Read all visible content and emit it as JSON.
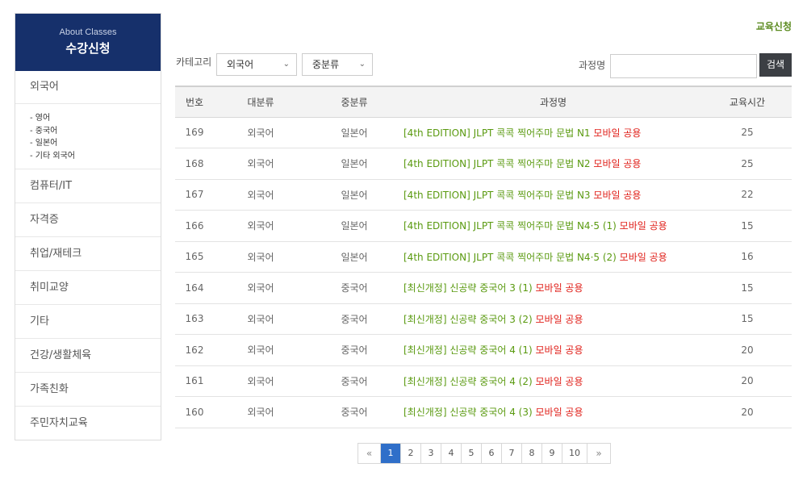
{
  "sidebar": {
    "subtitle": "About Classes",
    "title": "수강신청",
    "first_item": "외국어",
    "sub_items": [
      "- 영어",
      "- 중국어",
      "- 일본어",
      "- 기타 외국어"
    ],
    "items": [
      "컴퓨터/IT",
      "자격증",
      "취업/재테크",
      "취미교양",
      "기타",
      "건강/생활체육",
      "가족친화",
      "주민자치교육"
    ]
  },
  "header": {
    "link": "교육신청"
  },
  "filters": {
    "category_label": "카테고리",
    "select1": "외국어",
    "select2": "중분류",
    "course_label": "과정명",
    "search_value": "",
    "search_button": "검색"
  },
  "table": {
    "headers": [
      "번호",
      "대분류",
      "중분류",
      "과정명",
      "교육시간"
    ],
    "rows": [
      {
        "no": "169",
        "cat": "외국어",
        "sub": "일본어",
        "title": "[4th EDITION] JLPT 콕콕 찍어주마 문법 N1",
        "mobile": "모바일 공용",
        "hours": "25"
      },
      {
        "no": "168",
        "cat": "외국어",
        "sub": "일본어",
        "title": "[4th EDITION] JLPT 콕콕 찍어주마 문법 N2",
        "mobile": "모바일 공용",
        "hours": "25"
      },
      {
        "no": "167",
        "cat": "외국어",
        "sub": "일본어",
        "title": "[4th EDITION] JLPT 콕콕 찍어주마 문법 N3",
        "mobile": "모바일 공용",
        "hours": "22"
      },
      {
        "no": "166",
        "cat": "외국어",
        "sub": "일본어",
        "title": "[4th EDITION] JLPT 콕콕 찍어주마 문법 N4·5 (1)",
        "mobile": "모바일 공용",
        "hours": "15"
      },
      {
        "no": "165",
        "cat": "외국어",
        "sub": "일본어",
        "title": "[4th EDITION] JLPT 콕콕 찍어주마 문법 N4·5 (2)",
        "mobile": "모바일 공용",
        "hours": "16"
      },
      {
        "no": "164",
        "cat": "외국어",
        "sub": "중국어",
        "title": "[최신개정] 신공략 중국어 3 (1)",
        "mobile": "모바일 공용",
        "hours": "15"
      },
      {
        "no": "163",
        "cat": "외국어",
        "sub": "중국어",
        "title": "[최신개정] 신공략 중국어 3 (2)",
        "mobile": "모바일 공용",
        "hours": "15"
      },
      {
        "no": "162",
        "cat": "외국어",
        "sub": "중국어",
        "title": "[최신개정] 신공략 중국어 4 (1)",
        "mobile": "모바일 공용",
        "hours": "20"
      },
      {
        "no": "161",
        "cat": "외국어",
        "sub": "중국어",
        "title": "[최신개정] 신공략 중국어 4 (2)",
        "mobile": "모바일 공용",
        "hours": "20"
      },
      {
        "no": "160",
        "cat": "외국어",
        "sub": "중국어",
        "title": "[최신개정] 신공략 중국어 4 (3)",
        "mobile": "모바일 공용",
        "hours": "20"
      }
    ]
  },
  "pagination": {
    "prev": "«",
    "pages": [
      "1",
      "2",
      "3",
      "4",
      "5",
      "6",
      "7",
      "8",
      "9",
      "10"
    ],
    "active": "1",
    "next": "»"
  }
}
